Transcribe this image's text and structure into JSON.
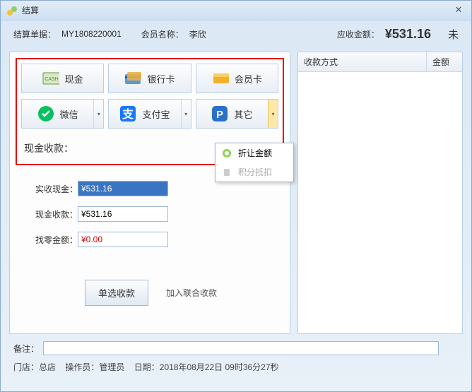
{
  "window": {
    "title": "结算"
  },
  "info": {
    "order_label": "结算单据：",
    "order_no": "MY1808220001",
    "member_label": "会员名称：",
    "member_name": "李欣",
    "due_label": "应收金额：",
    "due_amount": "¥531.16",
    "trail": "未"
  },
  "payments": {
    "cash": "现金",
    "bank": "银行卡",
    "member": "会员卡",
    "wechat": "微信",
    "alipay": "支付宝",
    "other": "其它"
  },
  "cash_section_label": "现金收款：",
  "form": {
    "actual_label": "实收现金：",
    "actual_value": "¥531.16",
    "cash_label": "现金收款：",
    "cash_value": "¥531.16",
    "change_label": "找零金额：",
    "change_value": "¥0.00"
  },
  "buttons": {
    "single": "单选收款",
    "combo": "加入联合收款"
  },
  "table": {
    "col1": "收款方式",
    "col2": "金额"
  },
  "dropdown": {
    "discount": "折让金额",
    "points": "积分抵扣"
  },
  "footer": {
    "remark_label": "备注：",
    "store_label": "门店：",
    "store": "总店",
    "operator_label": "操作员：",
    "operator": "管理员",
    "date_label": "日期：",
    "date": "2018年08月22日 09时36分27秒"
  }
}
